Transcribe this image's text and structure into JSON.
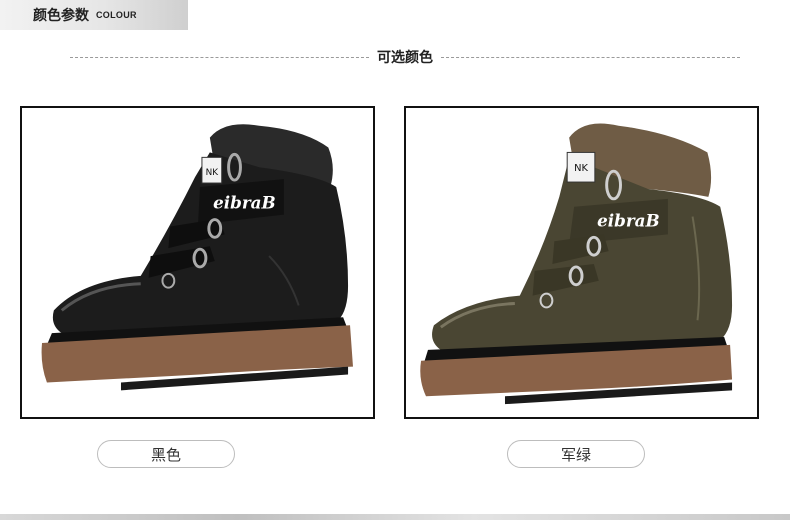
{
  "header": {
    "title_zh": "颜色参数",
    "title_en": "COLOUR"
  },
  "section": {
    "title": "可选颜色"
  },
  "products": [
    {
      "label": "黑色",
      "brand_text": "eibraB",
      "tag_text": "NK",
      "upper_color": "#1c1c1c",
      "fur_color": "#2a2a2a",
      "sole_color": "#8a6248"
    },
    {
      "label": "军绿",
      "brand_text": "eibraB",
      "tag_text": "NK",
      "upper_color": "#4a4633",
      "fur_color": "#6f5c45",
      "sole_color": "#8a6248"
    }
  ]
}
